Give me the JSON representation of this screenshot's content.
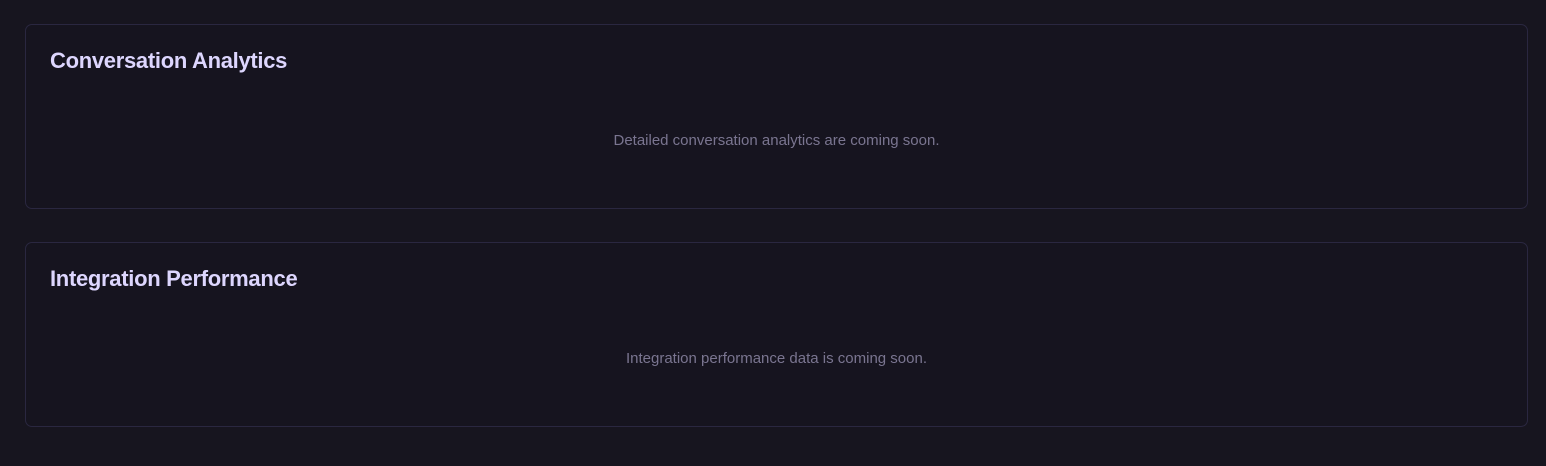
{
  "colors": {
    "background": "#17151f",
    "card_border": "#2a2740",
    "title": "#ddd6fe",
    "muted_text": "#7a7590"
  },
  "cards": [
    {
      "title": "Conversation Analytics",
      "message": "Detailed conversation analytics are coming soon."
    },
    {
      "title": "Integration Performance",
      "message": "Integration performance data is coming soon."
    }
  ]
}
